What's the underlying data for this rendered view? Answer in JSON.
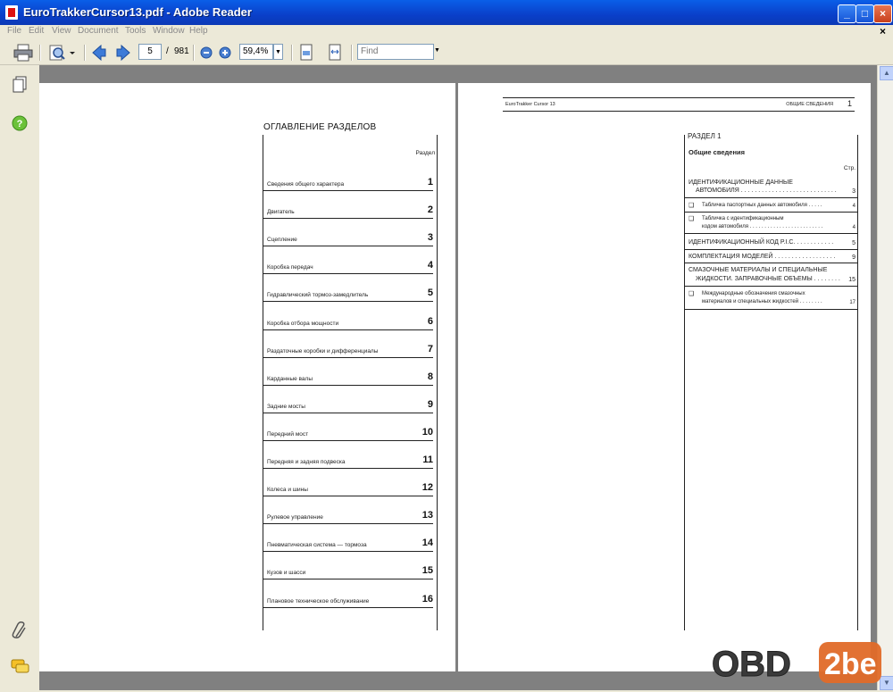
{
  "window": {
    "title": "EuroTrakkerCursor13.pdf - Adobe Reader"
  },
  "menu": {
    "items": [
      "File",
      "Edit",
      "View",
      "Document",
      "Tools",
      "Window",
      "Help"
    ],
    "close_doc": "×"
  },
  "toolbar": {
    "page_current": "5",
    "page_separator": "/",
    "page_total": "981",
    "zoom": "59,4%",
    "find_placeholder": "Find"
  },
  "left_page": {
    "title": "ОГЛАВЛЕНИЕ РАЗДЕЛОВ",
    "column_header": "Раздел",
    "rows": [
      {
        "label": "Сведения общего характера",
        "num": "1"
      },
      {
        "label": "Двигатель",
        "num": "2"
      },
      {
        "label": "Сцепление",
        "num": "3"
      },
      {
        "label": "Коробка передач",
        "num": "4"
      },
      {
        "label": "Гидравлический тормоз-замедлитель",
        "num": "5"
      },
      {
        "label": "Коробка отбора мощности",
        "num": "6"
      },
      {
        "label": "Раздаточные коробки и дифференциалы",
        "num": "7"
      },
      {
        "label": "Карданные валы",
        "num": "8"
      },
      {
        "label": "Задние мосты",
        "num": "9"
      },
      {
        "label": "Передний мост",
        "num": "10"
      },
      {
        "label": "Передняя и задняя подвеска",
        "num": "11"
      },
      {
        "label": "Колеса и шины",
        "num": "12"
      },
      {
        "label": "Рулевое управление",
        "num": "13"
      },
      {
        "label": "Пневматическая система — тормоза",
        "num": "14"
      },
      {
        "label": "Кузов и шасси",
        "num": "15"
      },
      {
        "label": "Плановое техническое обслуживание",
        "num": "16"
      }
    ]
  },
  "right_page": {
    "running_head_left": "EuroTrakker Cursor 13",
    "running_head_right": "ОБЩИЕ СВЕДЕНИЯ",
    "page_number": "1",
    "section_label": "РАЗДЕЛ 1",
    "section_title": "Общие сведения",
    "page_col_header": "Стр.",
    "e1_line1": "ИДЕНТИФИКАЦИОННЫЕ ДАННЫЕ",
    "e1_line2": "АВТОМОБИЛЯ . . . . . . . . . . . . . . . . . . . . . . . . . . . .",
    "e1_page": "3",
    "e2_text": "Табличка паспортных данных автомобиля . . . . .",
    "e2_page": "4",
    "e3_line1": "Табличка с идентификационным",
    "e3_line2": "кодом автомобиля . . . . . . . . . . . . . . . . . . . . . . . . .",
    "e3_page": "4",
    "e4_text": "ИДЕНТИФИКАЦИОННЫЙ КОД P.I.C. . . . . . . . . . . .",
    "e4_page": "5",
    "e5_text": "КОМПЛЕКТАЦИЯ МОДЕЛЕЙ . . . . . . . . . . . . . . . . . .",
    "e5_page": "9",
    "e6_line1": "СМАЗОЧНЫЕ МАТЕРИАЛЫ И СПЕЦИАЛЬНЫЕ",
    "e6_line2": "ЖИДКОСТИ. ЗАПРАВОЧНЫЕ ОБЪЕМЫ . . . . . . . .",
    "e6_page": "15",
    "e7_line1": "Международные обозначения смазочных",
    "e7_line2": "материалов и специальных жидкостей . . . . . . . .",
    "e7_page": "17"
  },
  "watermark": {
    "left": "OBD",
    "right": "2be"
  }
}
